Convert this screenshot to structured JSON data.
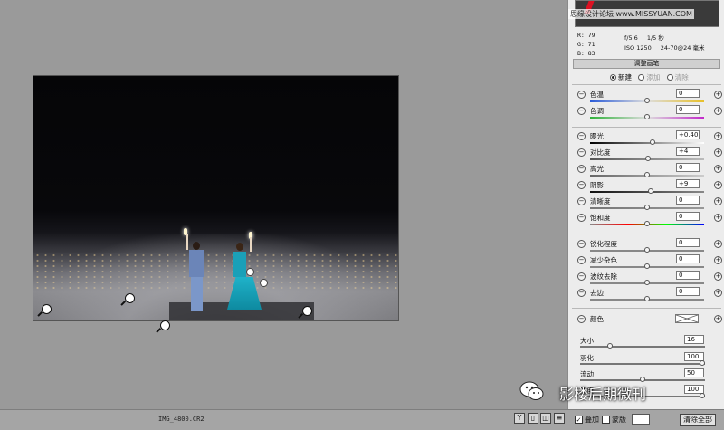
{
  "watermark_top": "思缘设计论坛 www.MISSYUAN.COM",
  "rgb": {
    "r": "R:  79",
    "g": "G:  71",
    "b": "B:  83"
  },
  "camera": {
    "aperture": "f/5.6",
    "shutter": "1/5 秒",
    "iso": "ISO 1250",
    "lens": "24-70@24 毫米"
  },
  "panel_title": "调整画笔",
  "modes": [
    {
      "label": "新建",
      "selected": true
    },
    {
      "label": "添加",
      "selected": false
    },
    {
      "label": "清除",
      "selected": false
    }
  ],
  "adjustments": [
    {
      "label": "色温",
      "value": "0",
      "knob": 0.5,
      "gradient": "linear-gradient(90deg,#2a5bd8,#ddd,#e7c02a)"
    },
    {
      "label": "色调",
      "value": "0",
      "knob": 0.5,
      "gradient": "linear-gradient(90deg,#2fb13a,#ddd,#c22ac9)"
    },
    {
      "label": "曝光",
      "value": "+0.40",
      "knob": 0.55,
      "gradient": "linear-gradient(90deg,#000,#fff)"
    },
    {
      "label": "对比度",
      "value": "+4",
      "knob": 0.51,
      "gradient": "linear-gradient(90deg,#555,#888,#bbb)"
    },
    {
      "label": "高光",
      "value": "0",
      "knob": 0.5,
      "gradient": "linear-gradient(90deg,#666,#ccc)"
    },
    {
      "label": "阴影",
      "value": "+9",
      "knob": 0.53,
      "gradient": "linear-gradient(90deg,#111,#888)"
    },
    {
      "label": "清晰度",
      "value": "0",
      "knob": 0.5,
      "gradient": "linear-gradient(90deg,#777,#999)"
    },
    {
      "label": "饱和度",
      "value": "0",
      "knob": 0.5,
      "gradient": "linear-gradient(90deg,#888,#f00,#0f0,#00f)"
    },
    {
      "label": "锐化程度",
      "value": "0",
      "knob": 0.5,
      "gradient": "linear-gradient(90deg,#888,#888)"
    },
    {
      "label": "减少杂色",
      "value": "0",
      "knob": 0.5,
      "gradient": "linear-gradient(90deg,#888,#888)"
    },
    {
      "label": "波纹去除",
      "value": "0",
      "knob": 0.5,
      "gradient": "linear-gradient(90deg,#888,#888)"
    },
    {
      "label": "去边",
      "value": "0",
      "knob": 0.5,
      "gradient": "linear-gradient(90deg,#888,#888)"
    }
  ],
  "color_label": "颜色",
  "brush": [
    {
      "label": "大小",
      "value": "16",
      "knob": 0.24
    },
    {
      "label": "羽化",
      "value": "100",
      "knob": 1.0
    },
    {
      "label": "流动",
      "value": "50",
      "knob": 0.5
    },
    {
      "label": "浓度",
      "value": "100",
      "knob": 1.0
    }
  ],
  "filename": "IMG_4800.CR2",
  "overlay_label": "叠加",
  "mask_label": "蒙版",
  "clear_all": "清除全部",
  "watermark": "影楼后期微刊"
}
